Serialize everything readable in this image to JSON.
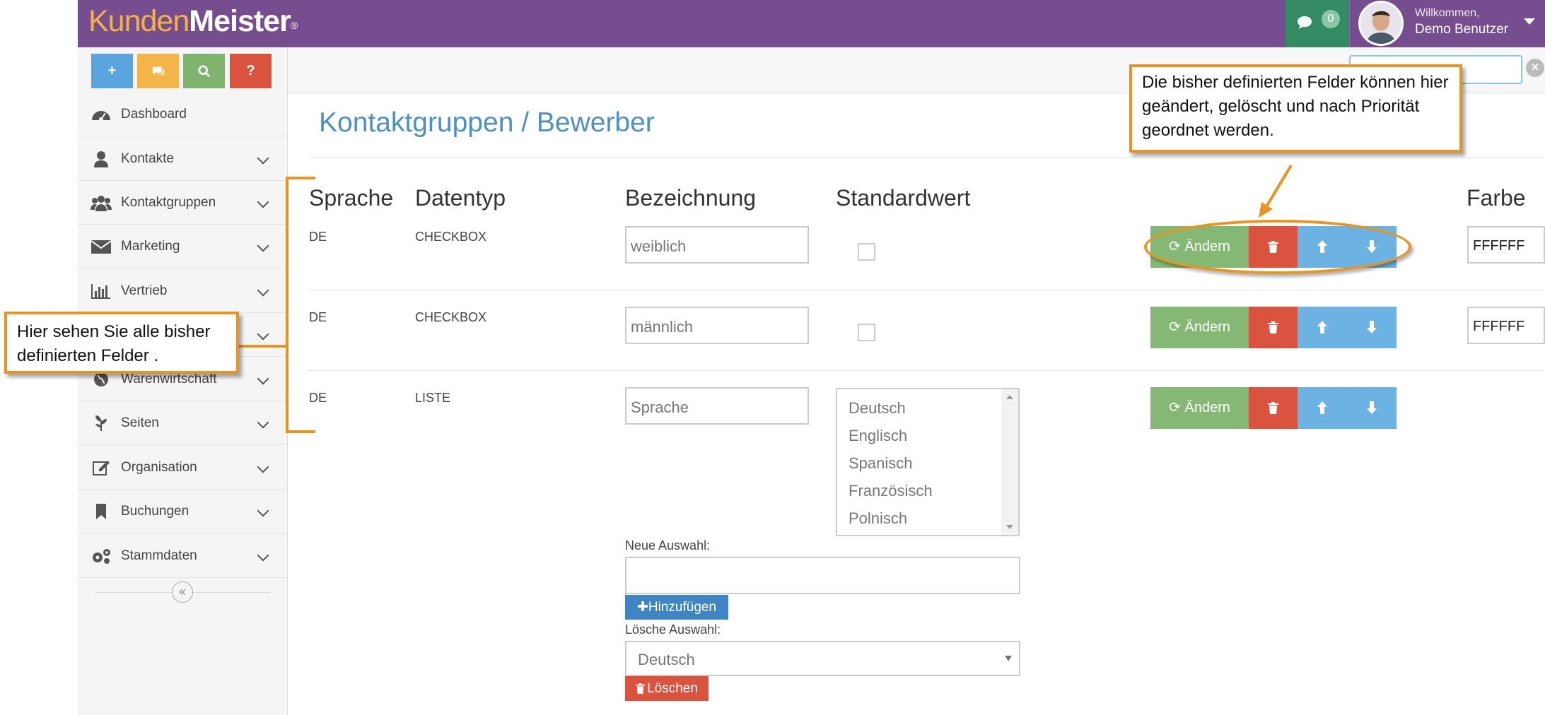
{
  "header": {
    "logo_part1": "Kunden",
    "logo_part2": "Meister",
    "logo_reg": "®",
    "message_count": "0",
    "welcome": "Willkommen,",
    "user_name": "Demo Benutzer"
  },
  "sidebar": {
    "quick_buttons": [
      {
        "label": "+",
        "color": "#5aa5dd"
      },
      {
        "label": "chat-icon",
        "color": "#f3b54a"
      },
      {
        "label": "search-icon",
        "color": "#7fb46e"
      },
      {
        "label": "?",
        "color": "#d9533f"
      }
    ],
    "items": [
      {
        "label": "Dashboard",
        "icon": "dashboard-icon"
      },
      {
        "label": "Kontakte",
        "icon": "user-icon"
      },
      {
        "label": "Kontaktgruppen",
        "icon": "users-icon"
      },
      {
        "label": "Marketing",
        "icon": "envelope-icon"
      },
      {
        "label": "Vertrieb",
        "icon": "bar-chart-icon"
      },
      {
        "label": "",
        "icon": "hidden-icon"
      },
      {
        "label": "Warenwirtschaft",
        "icon": "globe-icon"
      },
      {
        "label": "Seiten",
        "icon": "leaf-icon"
      },
      {
        "label": "Organisation",
        "icon": "edit-icon"
      },
      {
        "label": "Buchungen",
        "icon": "bookmark-icon"
      },
      {
        "label": "Stammdaten",
        "icon": "gears-icon"
      }
    ]
  },
  "main": {
    "title": "Kontaktgruppen / Bewerber",
    "columns": [
      "Sprache",
      "Datentyp",
      "Bezeichnung",
      "Standardwert",
      "Farbe"
    ],
    "rows": [
      {
        "sprache": "DE",
        "datentyp": "CHECKBOX",
        "bezeichnung": "weiblich",
        "farbe": "FFFFFF",
        "button": "Ändern"
      },
      {
        "sprache": "DE",
        "datentyp": "CHECKBOX",
        "bezeichnung": "männlich",
        "farbe": "FFFFFF",
        "button": "Ändern"
      },
      {
        "sprache": "DE",
        "datentyp": "LISTE",
        "bezeichnung": "Sprache",
        "button": "Ändern"
      }
    ],
    "list_options": [
      "Deutsch",
      "Englisch",
      "Spanisch",
      "Französisch",
      "Polnisch"
    ],
    "new_choice_label": "Neue Auswahl:",
    "add_button": "Hinzufügen",
    "delete_choice_label": "Lösche Auswahl:",
    "delete_selected": "Deutsch",
    "delete_button": "Löschen"
  },
  "callouts": {
    "top": "Die bisher definierten Felder können hier geändert, gelöscht und nach Priorität geordnet werden.",
    "left": "Hier sehen Sie alle bisher definierten Felder ."
  },
  "colors": {
    "header": "#764e8f",
    "accent_orange": "#e89420",
    "green_button": "#84b874",
    "red_button": "#d9533f",
    "blue_button": "#6cb2e2"
  }
}
